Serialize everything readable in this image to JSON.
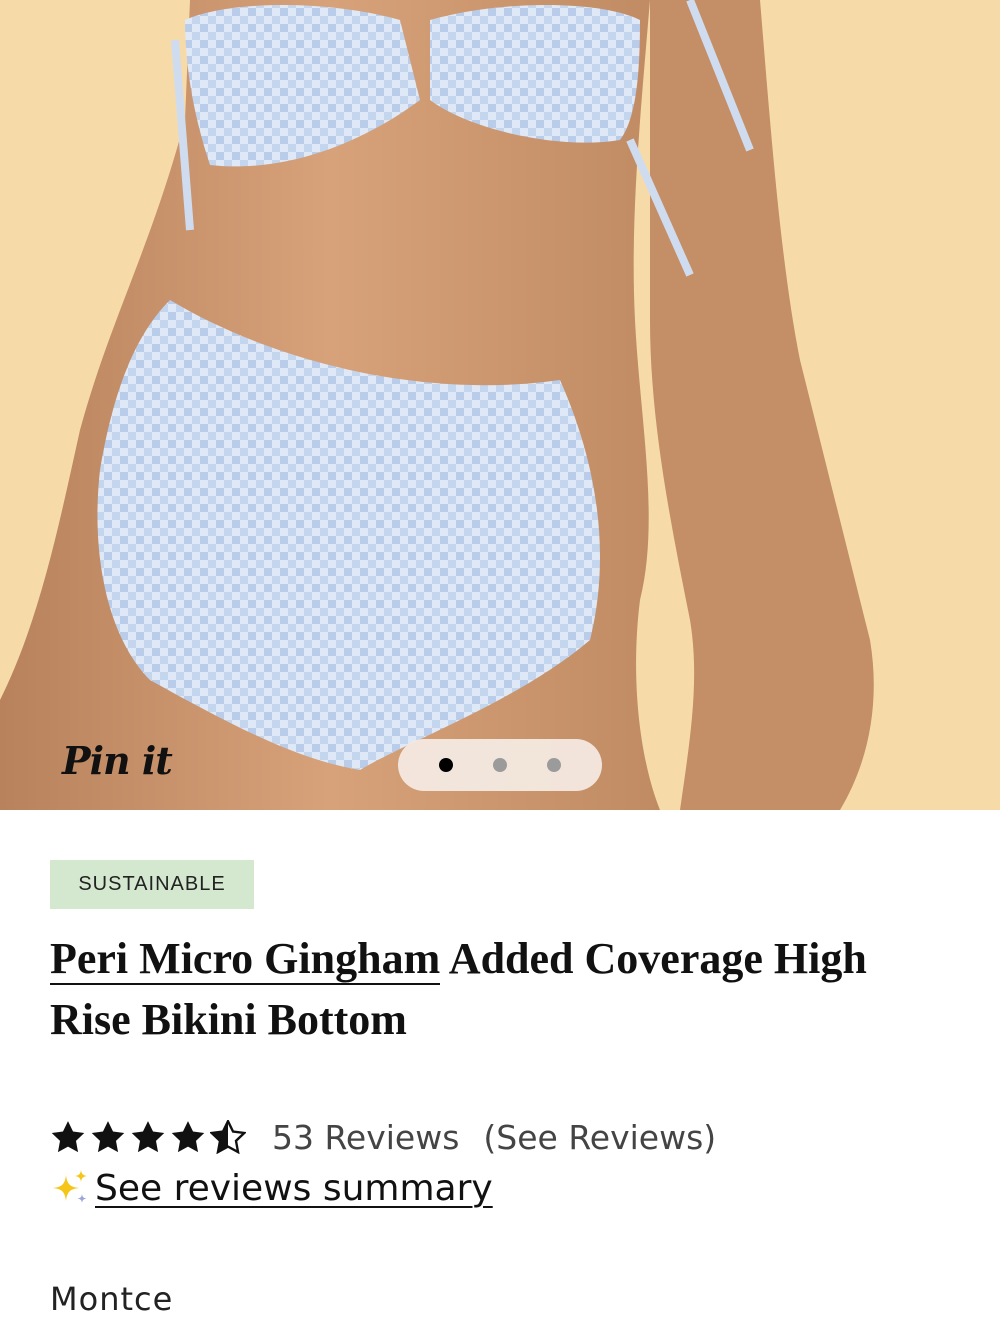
{
  "product_image": {
    "pin_label": "Pin it",
    "carousel": {
      "count": 3,
      "active_index": 0
    }
  },
  "product": {
    "badge": "SUSTAINABLE",
    "title_link": "Peri Micro Gingham",
    "title_rest": " Added Coverage High Rise Bikini Bottom",
    "rating": 4.5,
    "reviews_count": "53 Reviews",
    "see_reviews": "(See Reviews)",
    "summary_link": "See reviews summary",
    "brand": "Montce"
  },
  "colors": {
    "background": "#f6dba8",
    "badge_bg": "#d4e8cf",
    "star": "#111111",
    "sparkle": "#f5c518"
  },
  "icons": {
    "stars": "star-icon",
    "sparkle": "sparkle-icon"
  }
}
